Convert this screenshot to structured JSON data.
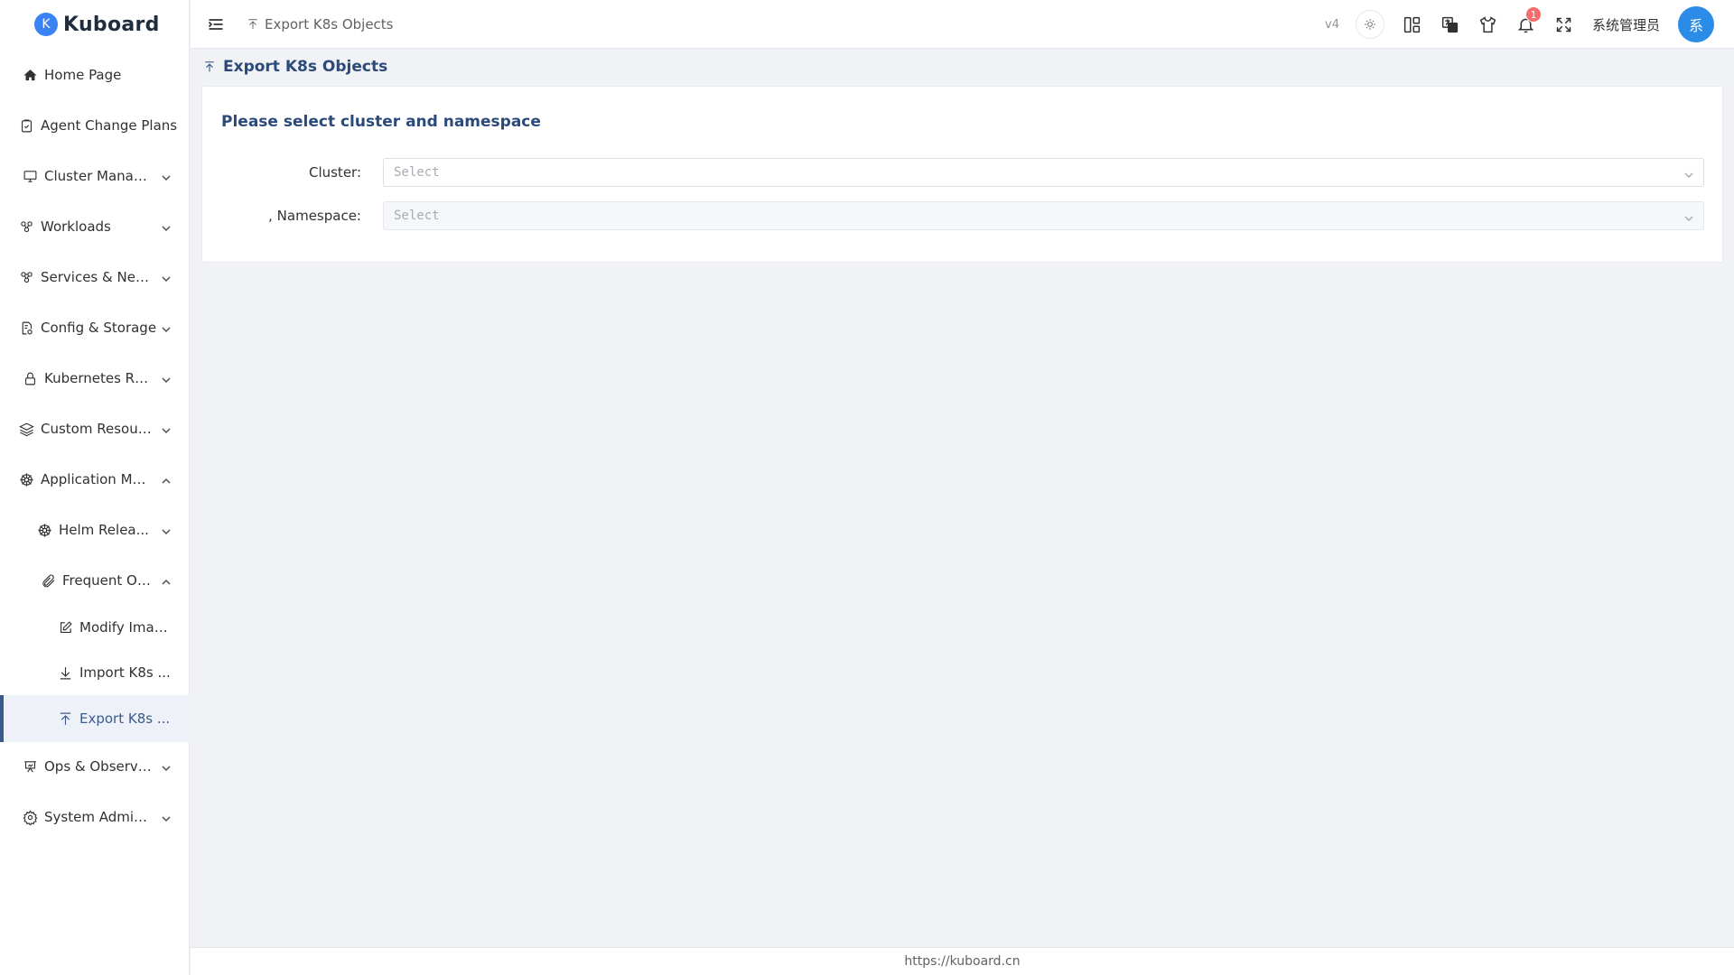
{
  "app": {
    "name": "Kuboard",
    "logo_letter": "K"
  },
  "sidebar": {
    "items": [
      {
        "label": "Home Page",
        "icon": "home-icon"
      },
      {
        "label": "Agent Change Plans",
        "icon": "clipboard-check-icon"
      },
      {
        "label": "Cluster Manag...",
        "icon": "monitor-icon"
      },
      {
        "label": "Workloads",
        "icon": "cluster-nodes-icon"
      },
      {
        "label": "Services & Net...",
        "icon": "network-nodes-icon"
      },
      {
        "label": "Config & Storage",
        "icon": "config-file-icon"
      },
      {
        "label": "Kubernetes RB...",
        "icon": "lock-icon"
      },
      {
        "label": "Custom Resour...",
        "icon": "layers-icon"
      },
      {
        "label": "Application Ma...",
        "icon": "helm-wheel-icon"
      },
      {
        "label": "Helm Relea...",
        "icon": "helm-wheel-icon"
      },
      {
        "label": "Frequent Op...",
        "icon": "paperclip-icon"
      },
      {
        "label": "Modify Imag...",
        "icon": "edit-icon"
      },
      {
        "label": "Import K8s ...",
        "icon": "download-icon"
      },
      {
        "label": "Export K8s ...",
        "icon": "upload-icon"
      },
      {
        "label": "Ops & Observa...",
        "icon": "presentation-icon"
      },
      {
        "label": "System Admini...",
        "icon": "gear-icon"
      }
    ]
  },
  "header": {
    "breadcrumb": "Export K8s Objects",
    "version": "v4",
    "notification_count": "1",
    "username": "系统管理员",
    "avatar_letter": "系"
  },
  "main": {
    "page_title": "Export K8s Objects",
    "card_title": "Please select cluster and namespace",
    "form": {
      "cluster_label": "Cluster:",
      "cluster_placeholder": "Select",
      "namespace_label": ", Namespace:",
      "namespace_placeholder": "Select"
    }
  },
  "footer": {
    "url": "https://kuboard.cn"
  },
  "colors": {
    "accent": "#3a5a8c",
    "title": "#2b4a7a",
    "badge": "#f56c6c",
    "avatar": "#2b8ce8"
  }
}
